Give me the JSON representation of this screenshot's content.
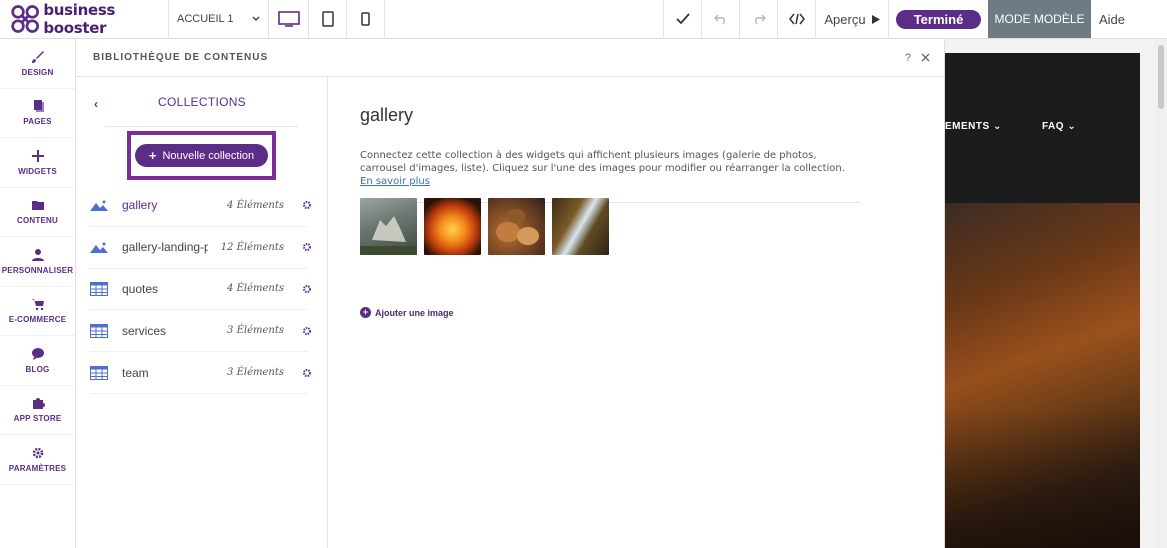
{
  "topbar": {
    "brand": "business booster",
    "page_select": "ACCUEIL 1",
    "apercu": "Aperçu",
    "termine": "Terminé",
    "mode_modele": "MODE MODÈLE",
    "aide": "Aide"
  },
  "sidebar": {
    "items": [
      {
        "label": "DESIGN",
        "icon": "brush-icon"
      },
      {
        "label": "PAGES",
        "icon": "pages-icon"
      },
      {
        "label": "WIDGETS",
        "icon": "plus-icon"
      },
      {
        "label": "CONTENU",
        "icon": "folder-icon"
      },
      {
        "label": "PERSONNALISER",
        "icon": "person-icon"
      },
      {
        "label": "E-COMMERCE",
        "icon": "cart-icon"
      },
      {
        "label": "BLOG",
        "icon": "chat-bubble-icon"
      },
      {
        "label": "APP STORE",
        "icon": "puzzle-icon"
      },
      {
        "label": "PARAMÈTRES",
        "icon": "gear-icon"
      }
    ]
  },
  "library": {
    "title": "BIBLIOTHÈQUE DE CONTENUS",
    "help": "?",
    "collections_label": "COLLECTIONS",
    "new_collection": "Nouvelle collection",
    "collections": [
      {
        "name": "gallery",
        "count": "4 Éléments",
        "icon": "gallery-icon"
      },
      {
        "name": "gallery-landing-p...",
        "count": "12 Éléments",
        "icon": "gallery-icon"
      },
      {
        "name": "quotes",
        "count": "4 Éléments",
        "icon": "table-icon"
      },
      {
        "name": "services",
        "count": "3 Éléments",
        "icon": "table-icon"
      },
      {
        "name": "team",
        "count": "3 Éléments",
        "icon": "table-icon"
      }
    ],
    "detail": {
      "title": "gallery",
      "description": "Connectez cette collection à des widgets qui affichent plusieurs images (galerie de photos, carrousel d'images, liste). Cliquez sur l'une des images pour modifier ou réarranger la collection.",
      "learn_more": "En savoir plus",
      "add_image": "Ajouter une image"
    }
  },
  "preview": {
    "nav_items": [
      "EMENTS",
      "FAQ"
    ]
  },
  "colors": {
    "brand_purple": "#5b2d86",
    "highlight_frame": "#7a2e98",
    "mode_modele_bg": "#6d7b82"
  }
}
